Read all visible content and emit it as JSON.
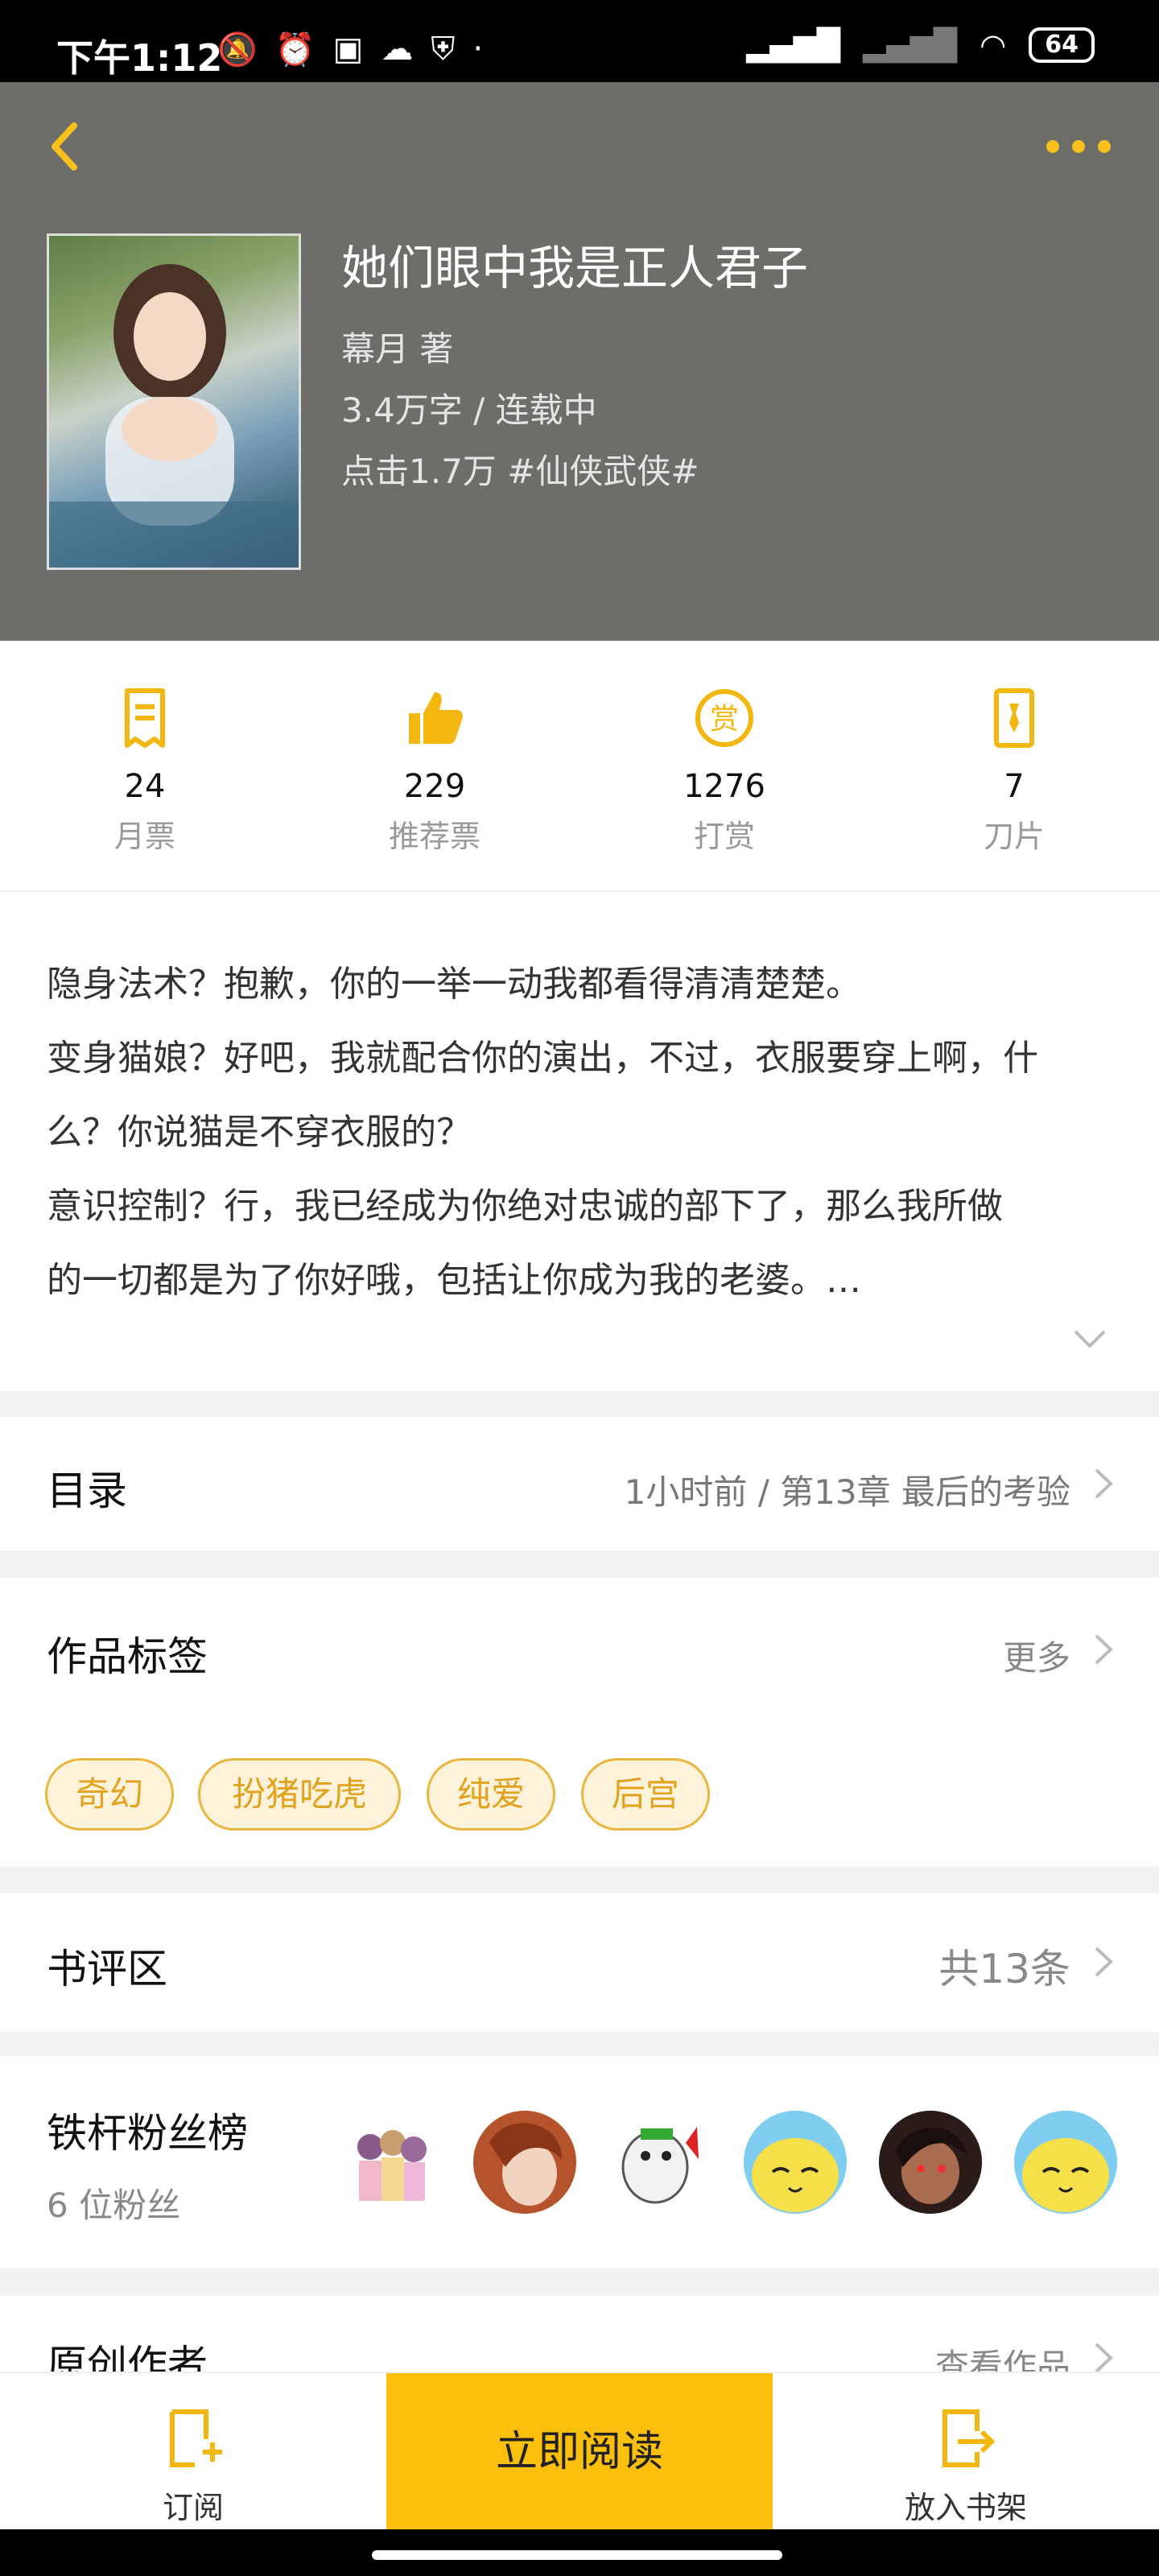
{
  "status_bar": {
    "time": "下午1:12",
    "battery": "64"
  },
  "book": {
    "title": "她们眼中我是正人君子",
    "author": "幕月  著",
    "words_status": "3.4万字 / 连载中",
    "clicks_genre": "点击1.7万  #仙侠武侠#"
  },
  "stats": [
    {
      "icon": "monthly-ticket-icon",
      "value": "24",
      "label": "月票"
    },
    {
      "icon": "thumbs-up-icon",
      "value": "229",
      "label": "推荐票"
    },
    {
      "icon": "reward-icon",
      "value": "1276",
      "label": "打赏"
    },
    {
      "icon": "blade-icon",
      "value": "7",
      "label": "刀片"
    }
  ],
  "description": {
    "lines": [
      "隐身法术？抱歉，你的一举一动我都看得清清楚楚。",
      "变身猫娘？好吧，我就配合你的演出，不过，衣服要穿上啊，什",
      "么？你说猫是不穿衣服的？",
      "意识控制？行，我已经成为你绝对忠诚的部下了，那么我所做",
      "的一切都是为了你好哦，包括让你成为我的老婆。…"
    ]
  },
  "catalog": {
    "title": "目录",
    "latest": "1小时前 / 第13章 最后的考验"
  },
  "tags_section": {
    "title": "作品标签",
    "more": "更多",
    "tags": [
      "奇幻",
      "扮猪吃虎",
      "纯爱",
      "后宫"
    ]
  },
  "reviews": {
    "title": "书评区",
    "count": "共13条"
  },
  "fans": {
    "title": "铁杆粉丝榜",
    "count": "6 位粉丝"
  },
  "author_section": {
    "title": "原创作者",
    "link": "查看作品"
  },
  "bottom_bar": {
    "subscribe": "订阅",
    "read_now": "立即阅读",
    "add_shelf": "放入书架"
  },
  "colors": {
    "accent": "#fcc00c",
    "header_bg": "#6d6e6a",
    "tag_border": "#e9b63f",
    "tag_bg": "#fdf3da"
  }
}
